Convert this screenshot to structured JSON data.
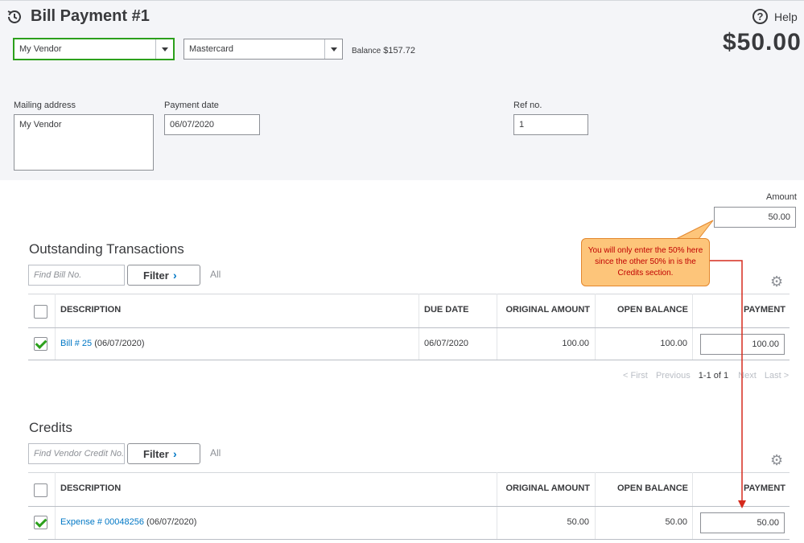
{
  "header": {
    "title": "Bill Payment #1",
    "help_label": "Help",
    "help_glyph": "?",
    "amount_display": "$50.00"
  },
  "payee": {
    "value": "My Vendor"
  },
  "account": {
    "value": "Mastercard",
    "balance_label": "Balance",
    "balance_value": "$157.72"
  },
  "mailing": {
    "label": "Mailing address",
    "value": "My Vendor"
  },
  "payment_date": {
    "label": "Payment date",
    "value": "06/07/2020"
  },
  "ref_no": {
    "label": "Ref no.",
    "value": "1"
  },
  "amount": {
    "label": "Amount",
    "value": "50.00"
  },
  "outstanding": {
    "title": "Outstanding Transactions",
    "find_placeholder": "Find Bill No.",
    "filter_label": "Filter",
    "all_label": "All",
    "columns": [
      "DESCRIPTION",
      "DUE DATE",
      "ORIGINAL AMOUNT",
      "OPEN BALANCE",
      "PAYMENT"
    ],
    "rows": [
      {
        "link": "Bill # 25",
        "date_suffix": " (06/07/2020)",
        "due_date": "06/07/2020",
        "original": "100.00",
        "open": "100.00",
        "payment": "100.00",
        "checked": true
      }
    ],
    "pager": {
      "first": "< First",
      "previous": "Previous",
      "range": "1-1 of 1",
      "next": "Next",
      "last": "Last >"
    }
  },
  "credits": {
    "title": "Credits",
    "find_placeholder": "Find Vendor Credit No.",
    "filter_label": "Filter",
    "all_label": "All",
    "columns": [
      "DESCRIPTION",
      "ORIGINAL AMOUNT",
      "OPEN BALANCE",
      "PAYMENT"
    ],
    "rows": [
      {
        "link": "Expense # 00048256",
        "date_suffix": " (06/07/2020)",
        "original": "50.00",
        "open": "50.00",
        "payment": "50.00",
        "checked": true
      }
    ]
  },
  "annotation": {
    "text": "You will only enter the 50% here since the other 50% in is the Credits section."
  },
  "colors": {
    "accent_green": "#2ca01c",
    "link_blue": "#0077c5",
    "callout_fill": "#fdc57a",
    "callout_text": "#c00000",
    "arrow_red": "#d52b1e"
  },
  "icons": [
    "history-icon",
    "help-icon",
    "chevron-right-icon",
    "gear-icon",
    "dropdown-caret-icon",
    "checkbox-checked-icon"
  ]
}
